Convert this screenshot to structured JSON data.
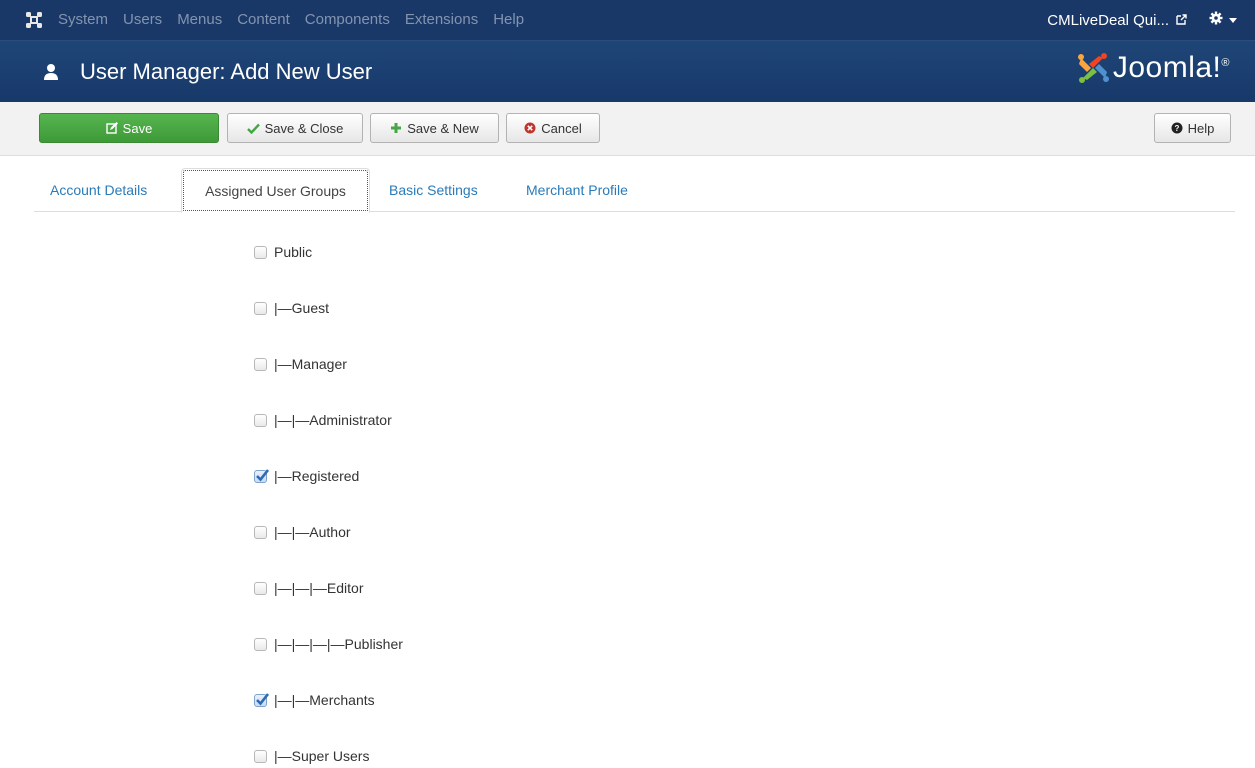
{
  "navbar": {
    "menu": [
      "System",
      "Users",
      "Menus",
      "Content",
      "Components",
      "Extensions",
      "Help"
    ],
    "site_name": "CMLiveDeal Qui...",
    "icons": {
      "logo": "joomla-icon",
      "external": "external-link-icon",
      "settings": "gear-icon"
    }
  },
  "header": {
    "title": "User Manager: Add New User",
    "brand": "Joomla!",
    "brand_mark": "®"
  },
  "toolbar": {
    "save_label": "Save",
    "save_close_label": "Save & Close",
    "save_new_label": "Save & New",
    "cancel_label": "Cancel",
    "help_label": "Help",
    "colors": {
      "save": "#46a546",
      "save_close_icon": "#46a546",
      "save_new_icon": "#46a546",
      "cancel_icon": "#bd362f"
    }
  },
  "tabs": [
    {
      "label": "Account Details",
      "active": false
    },
    {
      "label": "Assigned User Groups",
      "active": true
    },
    {
      "label": "Basic Settings",
      "active": false
    },
    {
      "label": "Merchant Profile",
      "active": false
    }
  ],
  "groups": [
    {
      "label": "Public",
      "checked": false
    },
    {
      "label": "|—Guest",
      "checked": false
    },
    {
      "label": "|—Manager",
      "checked": false
    },
    {
      "label": "|—|—Administrator",
      "checked": false
    },
    {
      "label": "|—Registered",
      "checked": true
    },
    {
      "label": "|—|—Author",
      "checked": false
    },
    {
      "label": "|—|—|—Editor",
      "checked": false
    },
    {
      "label": "|—|—|—|—Publisher",
      "checked": false
    },
    {
      "label": "|—|—Merchants",
      "checked": true
    },
    {
      "label": "|—Super Users",
      "checked": false
    }
  ],
  "theme": {
    "navbar_bg": "#1a3867",
    "link": "#2a7bb9"
  }
}
